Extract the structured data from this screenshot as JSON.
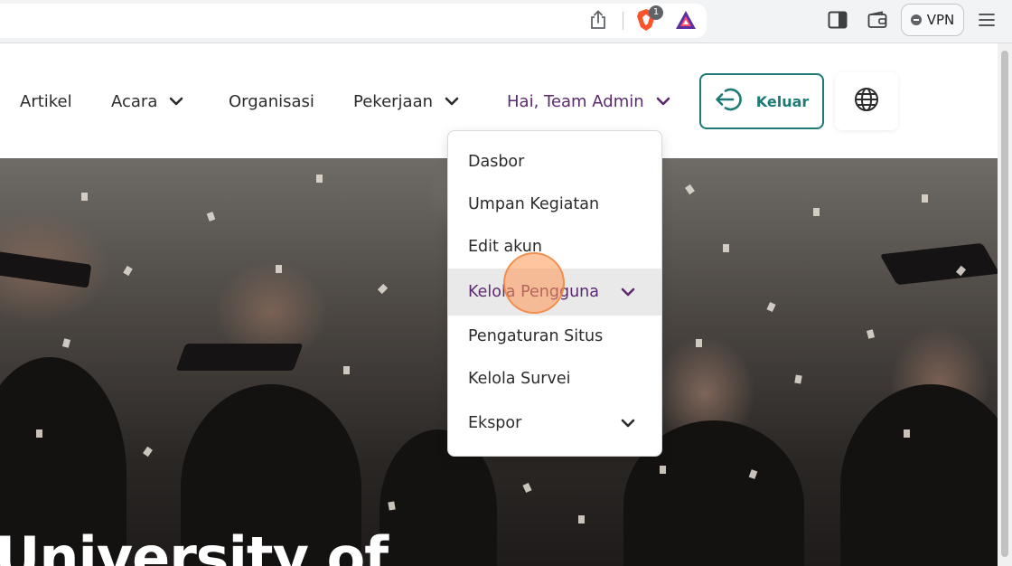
{
  "browser": {
    "brave_badge_count": "1",
    "vpn_label": "VPN"
  },
  "nav": {
    "items": [
      {
        "label": "Artikel"
      },
      {
        "label": "Acara"
      },
      {
        "label": "Organisasi"
      },
      {
        "label": "Pekerjaan"
      },
      {
        "label": "Hai, Team Admin"
      }
    ],
    "logout_label": "Keluar"
  },
  "dropdown": {
    "items": [
      {
        "label": "Dasbor"
      },
      {
        "label": "Umpan Kegiatan"
      },
      {
        "label": "Edit akun"
      },
      {
        "label": "Kelola Pengguna"
      },
      {
        "label": "Pengaturan Situs"
      },
      {
        "label": "Kelola Survei"
      },
      {
        "label": "Ekspor"
      }
    ]
  },
  "hero": {
    "title": "University of"
  },
  "colors": {
    "brand_purple": "#5b2a6e",
    "accent_teal": "#1d7a75",
    "highlight_bg": "#e9e9ea"
  }
}
